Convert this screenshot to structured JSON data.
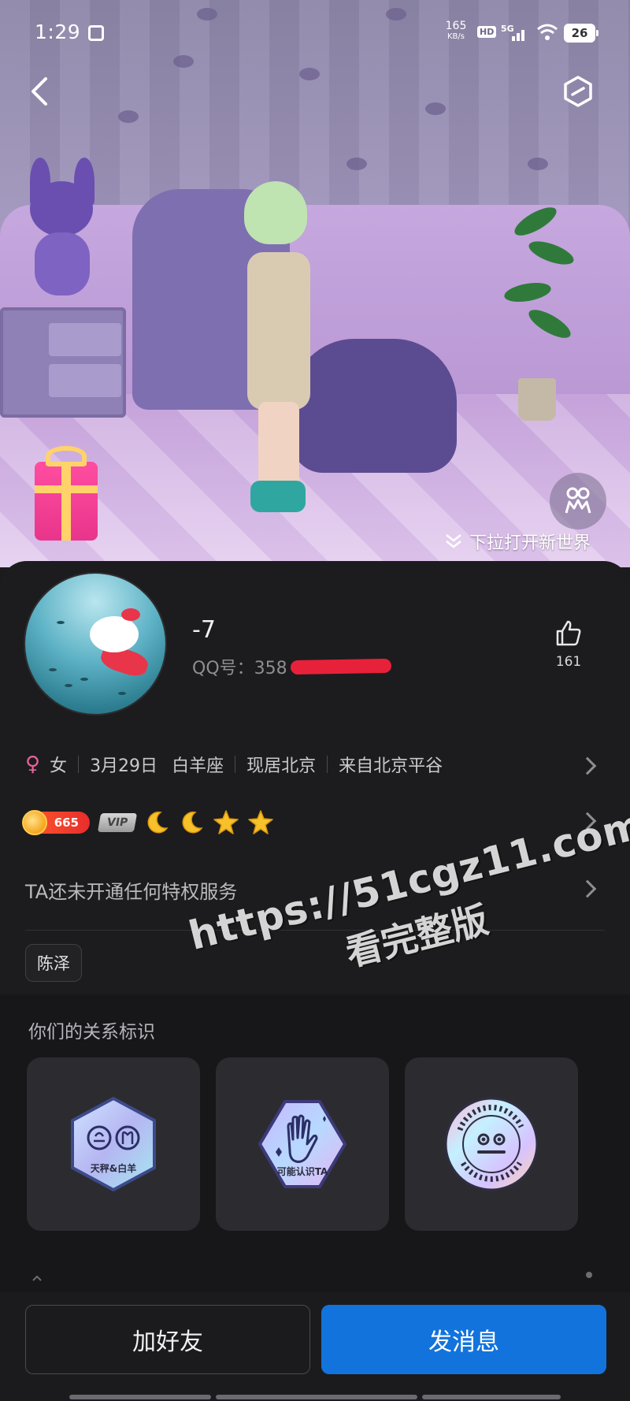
{
  "status_bar": {
    "time": "1:29",
    "net_speed": "165",
    "net_speed_unit": "KB/s",
    "hd": "HD",
    "network": "5G",
    "battery": "26"
  },
  "hero": {
    "pulldown_text": "下拉打开新世界"
  },
  "profile": {
    "nickname": "-7",
    "qq_label": "QQ号：358",
    "likes": "161",
    "gender": "女",
    "birthday": "3月29日",
    "zodiac": "白羊座",
    "location": "现居北京",
    "hometown": "来自北京平谷",
    "level": "665",
    "vip": "VIP",
    "privilege_text": "TA还未开通任何特权服务",
    "tag": "陈泽"
  },
  "relationship": {
    "title": "你们的关系标识",
    "cards": [
      {
        "label": "天秤&白羊",
        "icon": "zodiac-libra-aries-icon"
      },
      {
        "label": "可能认识TA",
        "icon": "waving-hand-icon"
      },
      {
        "label": "",
        "icon": "emoji-face-icon"
      }
    ]
  },
  "actions": {
    "add_friend": "加好友",
    "send_message": "发消息"
  },
  "watermark": {
    "line1": "https://51cgz11.com",
    "line2": "看完整版"
  },
  "colors": {
    "accent": "#1273dc",
    "female": "#e8619a",
    "level": "#e82d2d",
    "background": "#1c1c1e"
  }
}
